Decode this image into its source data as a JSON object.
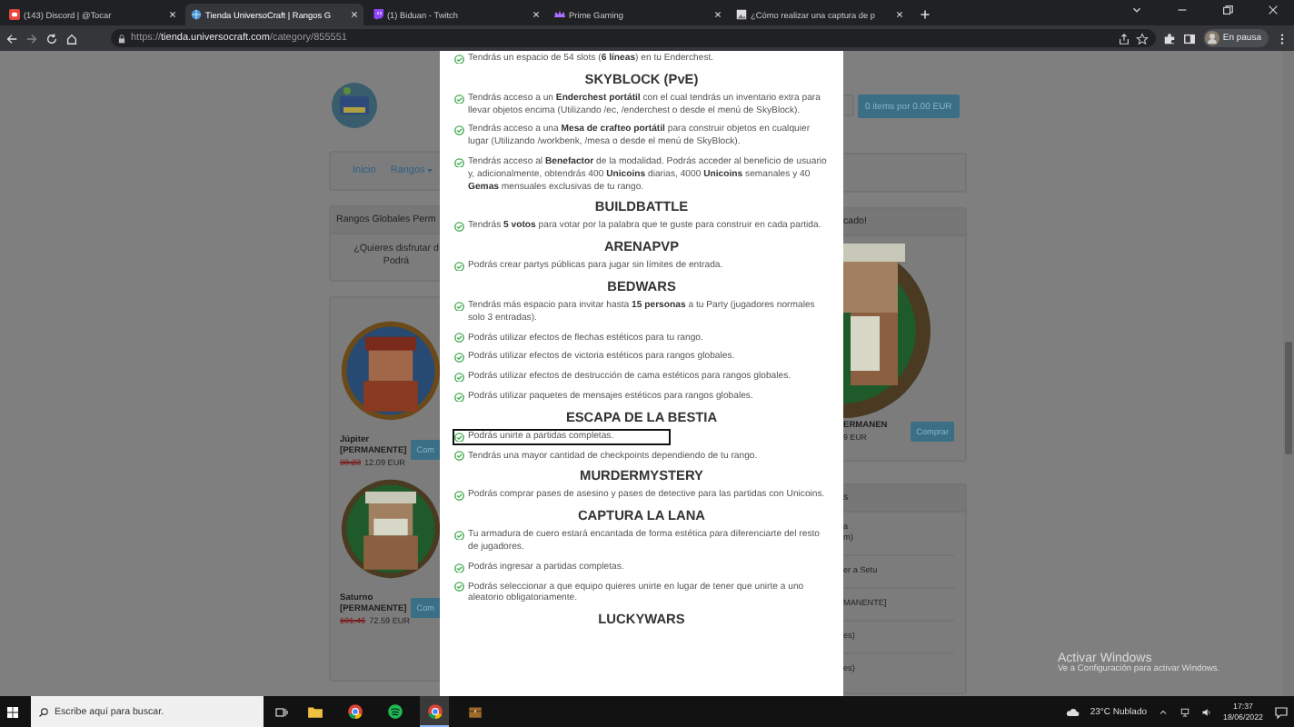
{
  "browser": {
    "tabs": [
      {
        "title": "(143) Discord | @Tocar",
        "kind": "discord",
        "selected": false
      },
      {
        "title": "Tienda UniversoCraft | Rangos G",
        "kind": "store",
        "selected": true
      },
      {
        "title": "(1) Biduan - Twitch",
        "kind": "twitch",
        "selected": false
      },
      {
        "title": "Prime Gaming",
        "kind": "prime",
        "selected": false
      },
      {
        "title": "¿Cómo realizar una captura de p",
        "kind": "doc",
        "selected": false
      }
    ],
    "url": {
      "scheme": "https://",
      "host": "tienda.universocraft.com",
      "path": "/category/855551"
    },
    "profile": "En pausa"
  },
  "store": {
    "cart_button": "0 items por 0.00 EUR",
    "nav": [
      "Inicio",
      "Rangos"
    ],
    "intro_card": {
      "header": "Rangos Globales Perm",
      "lines": [
        "¿Quieres disfrutar d",
        "Podrá"
      ]
    },
    "products": [
      {
        "kind": "fire",
        "name": "Júpiter",
        "duration": "[PERMANENTE]",
        "old_price": "30.23",
        "price": "12.09 EUR",
        "button": "Com"
      },
      {
        "kind": "nature",
        "name": "Saturno",
        "duration": "[PERMANENTE]",
        "old_price": "101.46",
        "price": "72.59 EUR",
        "button": "Com"
      }
    ],
    "featured": {
      "header": "cado!",
      "name": "ERMANEN",
      "price": "9 EUR",
      "button": "Comprar"
    },
    "side_list": {
      "header": "s",
      "items": [
        [
          "a",
          "m)"
        ],
        [
          "er a Setu"
        ],
        [
          "MANENTE]"
        ],
        [
          "es)"
        ],
        [
          "es)"
        ]
      ]
    }
  },
  "modal": {
    "blocks": [
      {
        "items": [
          {
            "text": "Tendrás un espacio de 54 slots (**6 líneas**) en tu Enderchest.",
            "highlighted": false
          }
        ]
      },
      {
        "heading": "SKYBLOCK (PvE)",
        "items": [
          {
            "text": "Tendrás acceso a un **Enderchest portátil** con el cual tendrás un inventario extra para llevar objetos encima (Utilizando /ec, /enderchest o desde el menú de SkyBlock).",
            "highlighted": false
          },
          {
            "text": "Tendrás acceso a una **Mesa de crafteo portátil** para construir objetos en cualquier lugar (Utilizando /workbenk, /mesa o desde el menú de SkyBlock).",
            "highlighted": false
          },
          {
            "text": "Tendrás acceso al **Benefactor** de la modalidad. Podrás acceder al beneficio de usuario y, adicionalmente, obtendrás 400 **Unicoins** diarias, 4000 **Unicoins** semanales y 40 **Gemas** mensuales exclusivas de tu rango.",
            "highlighted": false
          }
        ]
      },
      {
        "heading": "BUILDBATTLE",
        "items": [
          {
            "text": "Tendrás **5 votos** para votar por la palabra que te guste para construir en cada partida.",
            "highlighted": false
          }
        ]
      },
      {
        "heading": "ARENAPVP",
        "items": [
          {
            "text": "Podrás crear partys públicas para jugar sin límites de entrada.",
            "highlighted": false
          }
        ]
      },
      {
        "heading": "BEDWARS",
        "items": [
          {
            "text": "Tendrás más espacio para invitar hasta **15 personas** a tu Party (jugadores normales solo 3 entradas).",
            "highlighted": false
          },
          {
            "text": "Podrás utilizar efectos de flechas estéticos para tu rango.",
            "highlighted": false
          },
          {
            "text": "Podrás utilizar efectos de victoria estéticos para rangos globales.",
            "highlighted": false
          },
          {
            "text": "Podrás utilizar efectos de destrucción de cama estéticos para rangos globales.",
            "highlighted": false
          },
          {
            "text": "Podrás utilizar paquetes de mensajes estéticos para rangos globales.",
            "highlighted": false
          }
        ]
      },
      {
        "heading": "ESCAPA DE LA BESTIA",
        "items": [
          {
            "text": "Podrás unirte a partidas completas.",
            "highlighted": true
          },
          {
            "text": "Tendrás una mayor cantidad de checkpoints dependiendo de tu rango.",
            "highlighted": false
          }
        ]
      },
      {
        "heading": "MURDERMYSTERY",
        "items": [
          {
            "text": "Podrás comprar pases de asesino y pases de detective para las partidas con Unicoins.",
            "highlighted": false
          }
        ]
      },
      {
        "heading": "CAPTURA LA LANA",
        "items": [
          {
            "text": "Tu armadura de cuero estará encantada de forma estética para diferenciarte del resto de jugadores.",
            "highlighted": false
          },
          {
            "text": "Podrás ingresar a partidas completas.",
            "highlighted": false
          },
          {
            "text": "Podrás seleccionar a que equipo quieres unirte en lugar de tener que unirte a uno aleatorio obligatoriamente.",
            "highlighted": false
          }
        ]
      },
      {
        "heading": "LUCKYWARS"
      }
    ]
  },
  "windows_notice": {
    "title": "Activar Windows",
    "text": "Ve a Configuración para activar Windows."
  },
  "taskbar": {
    "search_placeholder": "Escribe aquí para buscar.",
    "apps": [
      {
        "kind": "explorer",
        "active": false
      },
      {
        "kind": "chrome",
        "active": false
      },
      {
        "kind": "spotify",
        "active": false
      },
      {
        "kind": "chrome",
        "active": true
      },
      {
        "kind": "chest",
        "active": false
      }
    ],
    "weather": "23°C Nublado",
    "time": "17:37",
    "date": "18/06/2022"
  }
}
